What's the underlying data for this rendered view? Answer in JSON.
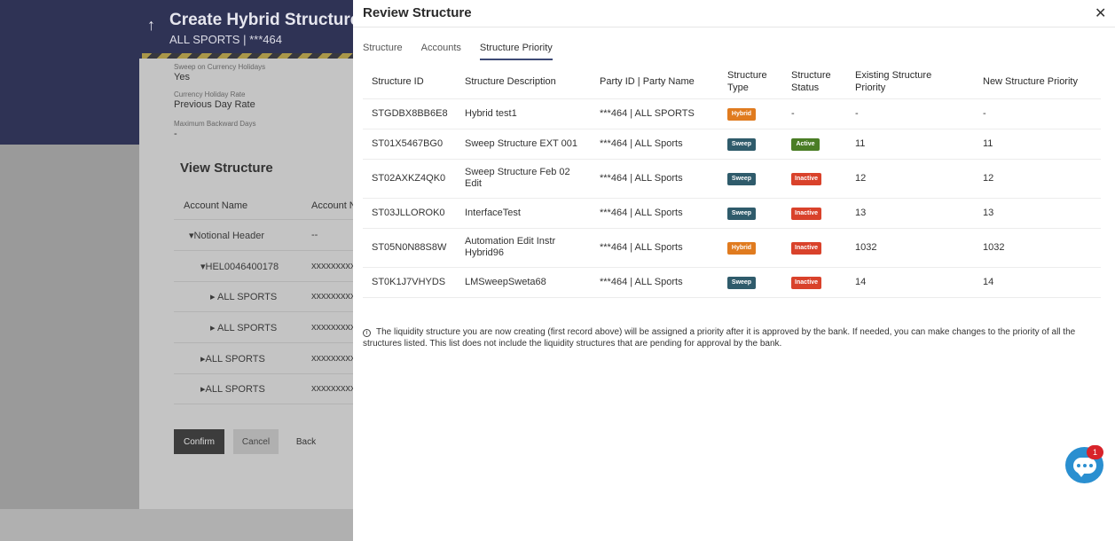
{
  "background": {
    "back_icon": "arrow-up-icon",
    "title": "Create Hybrid Structure",
    "subtitle": "ALL SPORTS | ***464",
    "fields": [
      {
        "label": "Sweep on Currency Holidays",
        "value": "Yes"
      },
      {
        "label": "Currency Holiday Rate",
        "value": "Previous Day Rate"
      },
      {
        "label": "Maximum Backward Days",
        "value": "-"
      }
    ],
    "view_title": "View Structure",
    "table_headers": [
      "Account Name",
      "Account N"
    ],
    "rows": [
      {
        "name": "Notional Header",
        "number": "--"
      },
      {
        "name": "HEL0046400178",
        "number": "xxxxxxxxx"
      },
      {
        "name": "ALL SPORTS",
        "number": "xxxxxxxxx"
      },
      {
        "name": "ALL SPORTS",
        "number": "xxxxxxxxx"
      },
      {
        "name": "ALL SPORTS",
        "number": "xxxxxxxxx"
      },
      {
        "name": "ALL SPORTS",
        "number": "xxxxxxxxx"
      }
    ],
    "buttons": {
      "confirm": "Confirm",
      "cancel": "Cancel",
      "back": "Back"
    }
  },
  "modal": {
    "title": "Review Structure",
    "close_icon": "close-icon",
    "tabs": [
      {
        "label": "Structure",
        "active": false
      },
      {
        "label": "Accounts",
        "active": false
      },
      {
        "label": "Structure Priority",
        "active": true
      }
    ],
    "columns": [
      "Structure ID",
      "Structure Description",
      "Party ID | Party Name",
      "Structure Type",
      "Structure Status",
      "Existing Structure Priority",
      "New Structure Priority"
    ],
    "rows": [
      {
        "id": "STGDBX8BB6E8",
        "description": "Hybrid test1",
        "party": "***464 | ALL SPORTS",
        "type": "Hybrid",
        "status": "-",
        "existing": "-",
        "new": "-"
      },
      {
        "id": "ST01X5467BG0",
        "description": "Sweep Structure EXT 001",
        "party": "***464 | ALL Sports",
        "type": "Sweep",
        "status": "Active",
        "existing": "11",
        "new": "11"
      },
      {
        "id": "ST02AXKZ4QK0",
        "description": "Sweep Structure Feb 02 Edit",
        "party": "***464 | ALL Sports",
        "type": "Sweep",
        "status": "Inactive",
        "existing": "12",
        "new": "12"
      },
      {
        "id": "ST03JLLOROK0",
        "description": "InterfaceTest",
        "party": "***464 | ALL Sports",
        "type": "Sweep",
        "status": "Inactive",
        "existing": "13",
        "new": "13"
      },
      {
        "id": "ST05N0N88S8W",
        "description": "Automation Edit Instr Hybrid96",
        "party": "***464 | ALL Sports",
        "type": "Hybrid",
        "status": "Inactive",
        "existing": "1032",
        "new": "1032"
      },
      {
        "id": "ST0K1J7VHYDS",
        "description": "LMSweepSweta68",
        "party": "***464 | ALL Sports",
        "type": "Sweep",
        "status": "Inactive",
        "existing": "14",
        "new": "14"
      }
    ],
    "info_icon": "info-icon",
    "info_text": "The liquidity structure you are now creating (first record above) will be assigned a priority after it is approved by the bank. If needed, you can make changes to the priority of all the structures listed. This list does not include the liquidity structures that are pending for approval by the bank."
  },
  "chat": {
    "icon": "chat-icon",
    "count": "1"
  },
  "colors": {
    "header_bg": "#2f3355",
    "tab_active": "#3d4a75",
    "hybrid": "#e07b1f",
    "sweep": "#2f5b6b",
    "active": "#4a7d25",
    "inactive": "#d9422b",
    "chat": "#2a8fd0"
  }
}
